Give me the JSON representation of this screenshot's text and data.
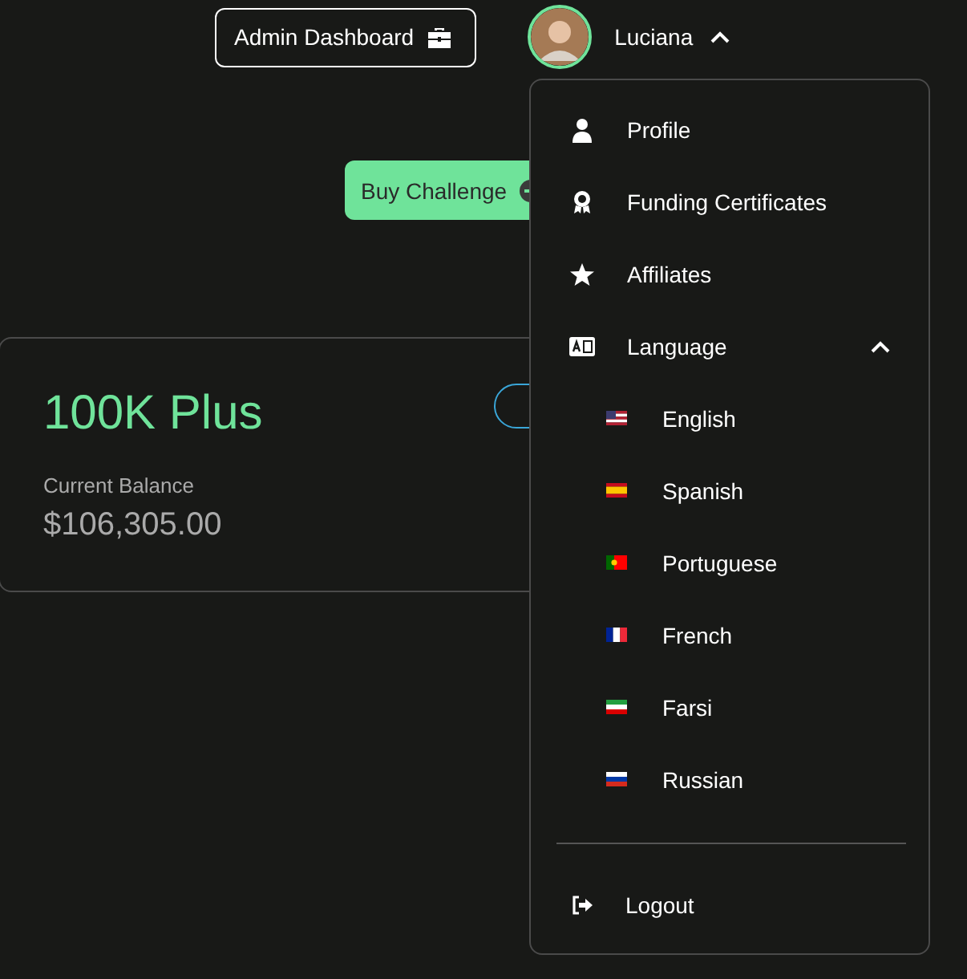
{
  "header": {
    "admin_button": "Admin Dashboard",
    "user": {
      "name": "Luciana",
      "menu_open": true
    }
  },
  "buy_button": "Buy Challenge",
  "account_card": {
    "title": "100K Plus",
    "balance_label": "Current Balance",
    "balance": "$106,305.00"
  },
  "user_menu": {
    "items": [
      {
        "kind": "profile",
        "label": "Profile"
      },
      {
        "kind": "certificate",
        "label": "Funding Certificates"
      },
      {
        "kind": "star",
        "label": "Affiliates"
      }
    ],
    "language": {
      "label": "Language",
      "expanded": true,
      "options": [
        {
          "kind": "us",
          "label": "English"
        },
        {
          "kind": "es",
          "label": "Spanish"
        },
        {
          "kind": "pt",
          "label": "Portuguese"
        },
        {
          "kind": "fr",
          "label": "French"
        },
        {
          "kind": "ir",
          "label": "Farsi"
        },
        {
          "kind": "ru",
          "label": "Russian"
        }
      ]
    },
    "logout": "Logout"
  }
}
